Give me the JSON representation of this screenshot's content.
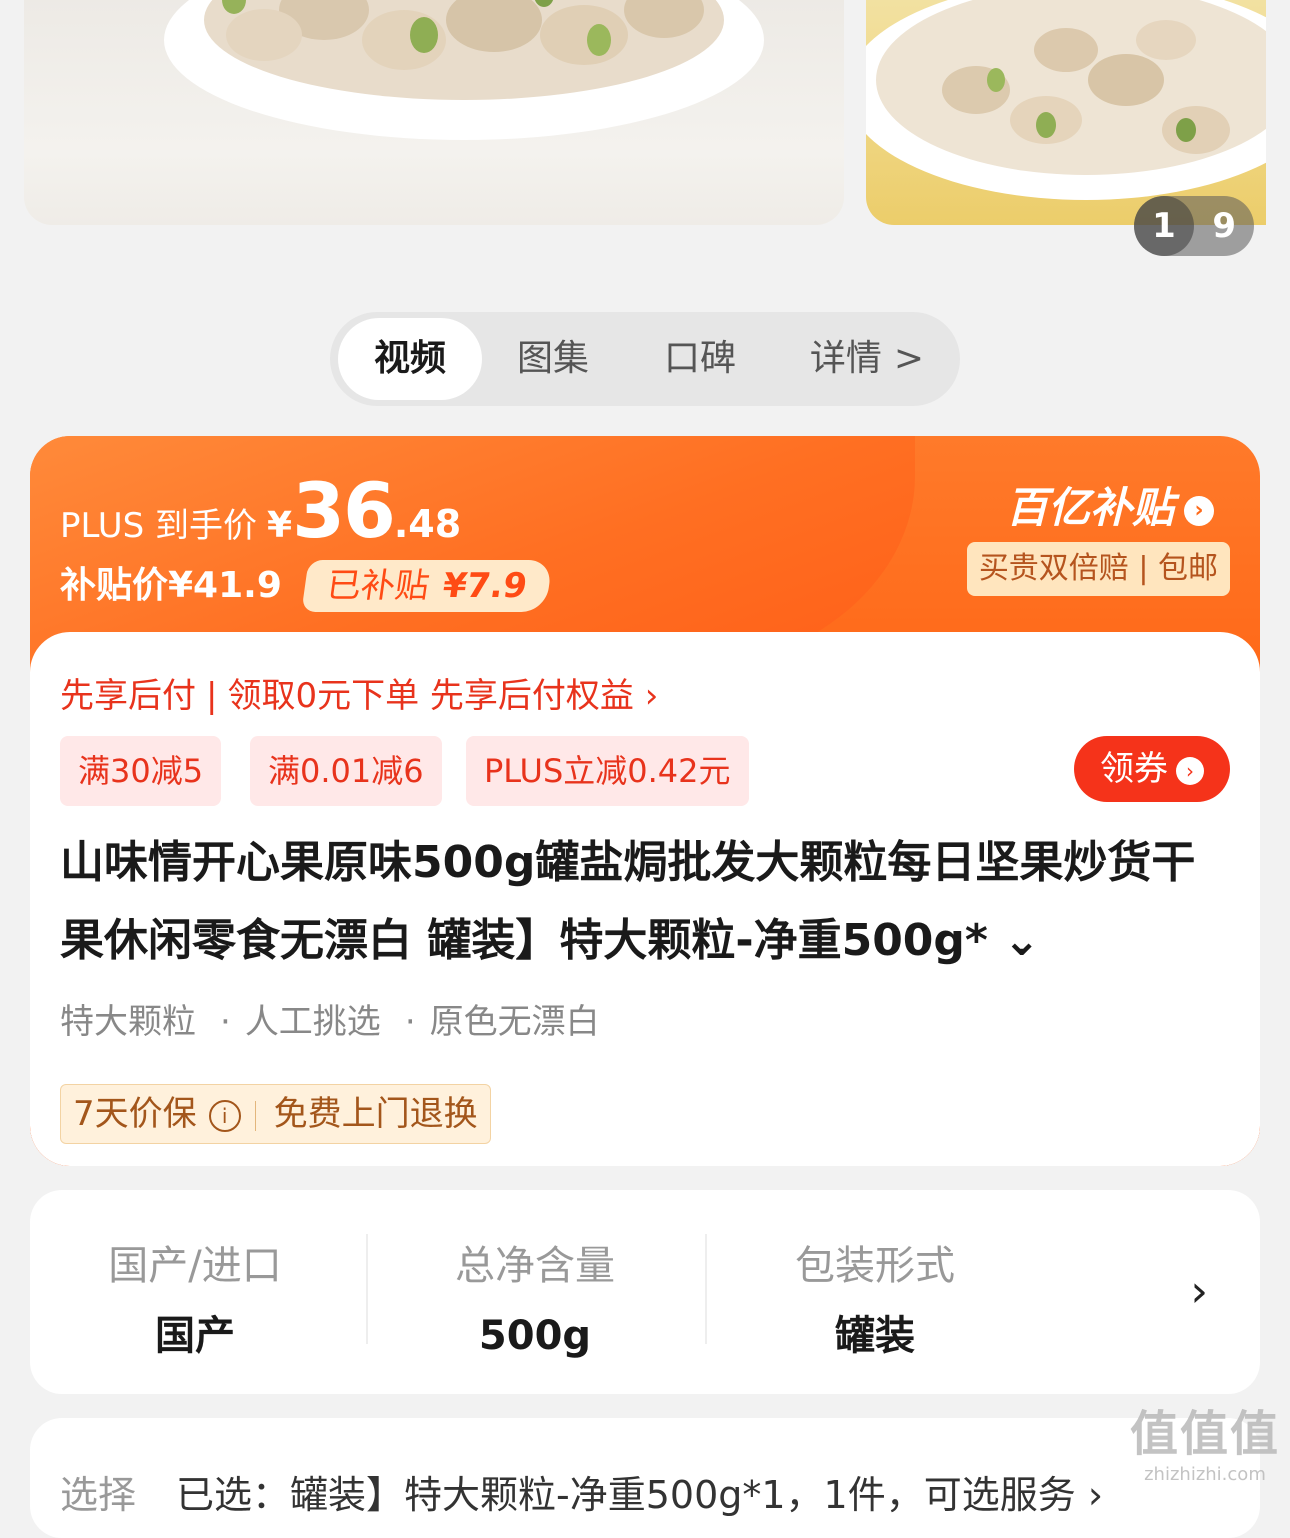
{
  "gallery": {
    "current": "1",
    "total": "9"
  },
  "tabs": [
    "视频",
    "图集",
    "口碑",
    "详情"
  ],
  "tab_more_arrow": ">",
  "price": {
    "plus_label": "PLUS 到手价",
    "currency": "¥",
    "integer": "36",
    "decimal": ".48",
    "subsidy_price_label": "补贴价¥41.9",
    "subsidy_tag_label": "已补贴",
    "subsidy_amount": "¥7.9"
  },
  "billion": {
    "logo": "百亿补贴",
    "guarantee": "买贵双倍赔 | 包邮"
  },
  "payline": {
    "part1": "先享后付",
    "sep": "|",
    "part2": "领取0元下单 先享后付权益",
    "arrow": "›"
  },
  "coupons": [
    "满30减5",
    "满0.01减6",
    "PLUS立减0.42元"
  ],
  "coupon_button": "领券",
  "title": "山味情开心果原味500g罐盐焗批发大颗粒每日坚果炒货干果休闲零食无漂白 罐装】特大颗粒-净重500g* ⌄",
  "features": [
    "特大颗粒",
    "人工挑选",
    "原色无漂白"
  ],
  "feature_dot": "·",
  "guarantee": {
    "price_protect": "7天价保",
    "info": "i",
    "return": "免费上门退换"
  },
  "specs": [
    {
      "label": "国产/进口",
      "value": "国产"
    },
    {
      "label": "总净含量",
      "value": "500g"
    },
    {
      "label": "包装形式",
      "value": "罐装"
    }
  ],
  "specs_more": "›",
  "select": {
    "label": "选择",
    "value": "已选：罐装】特大颗粒-净重500g*1，1件，可选服务 ›"
  },
  "watermark": {
    "big": "值值值",
    "small": "zhizhizhi.com"
  },
  "colors": {
    "accent_orange": "#ff6a1a",
    "accent_red": "#f5331a"
  }
}
